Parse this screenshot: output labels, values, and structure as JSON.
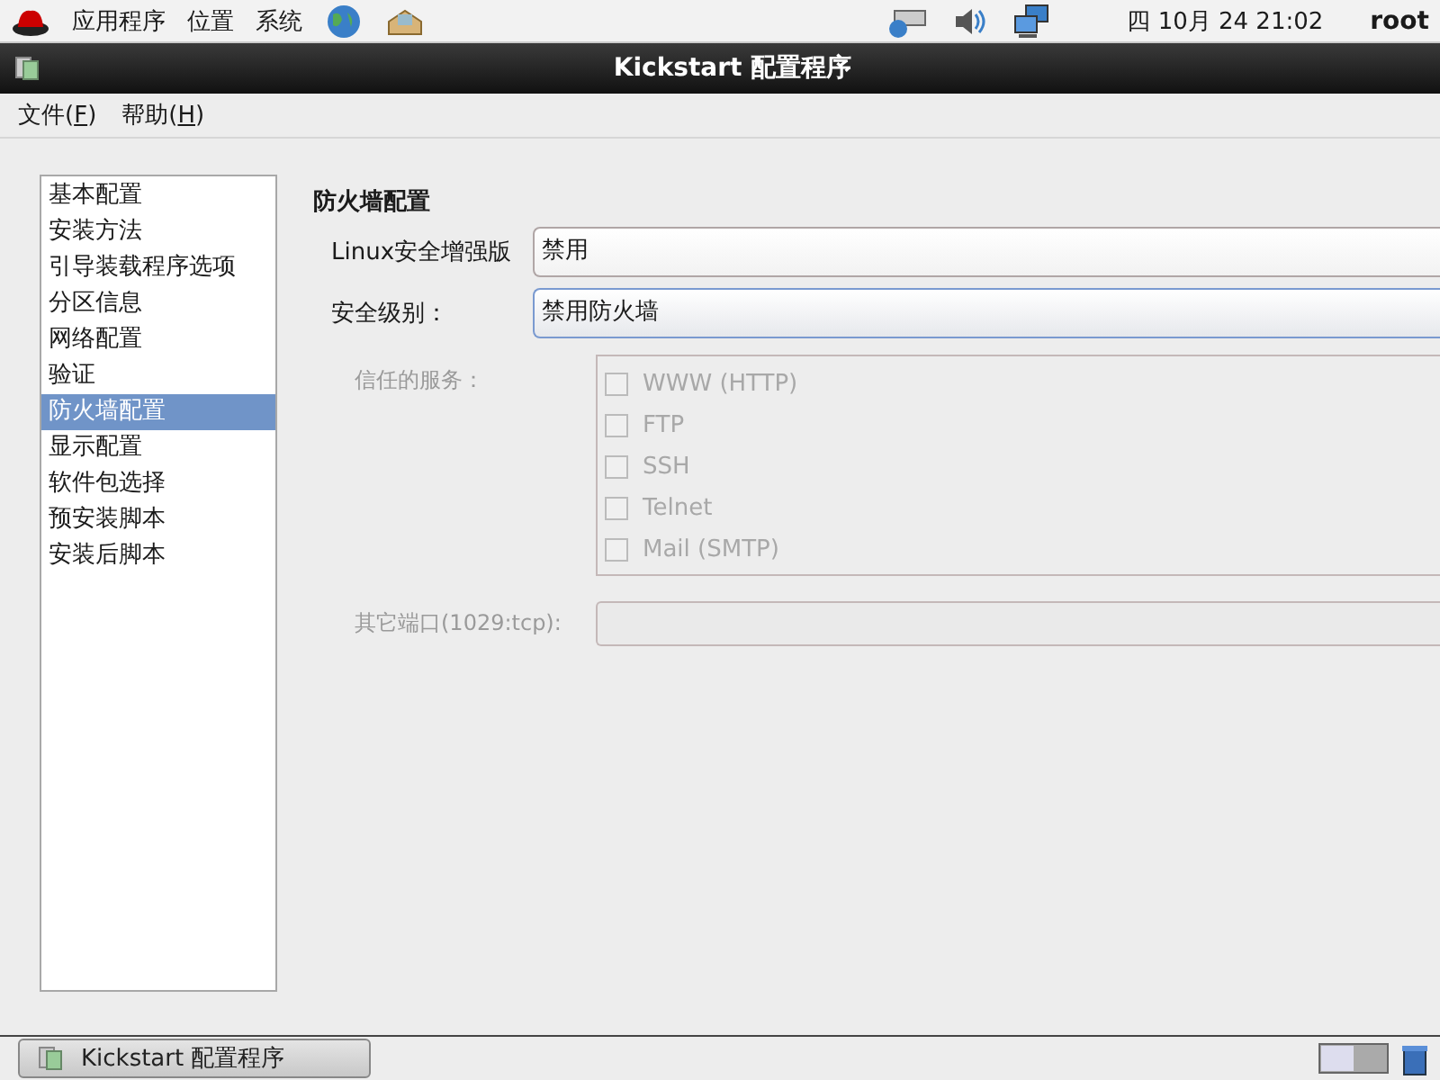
{
  "top_panel": {
    "menus": [
      "应用程序",
      "位置",
      "系统"
    ],
    "clock": "四 10月 24 21:02",
    "user": "root"
  },
  "window": {
    "title": "Kickstart 配置程序"
  },
  "menubar": [
    "文件(F)",
    "帮助(H)"
  ],
  "sidebar": {
    "items": [
      {
        "label": "基本配置",
        "selected": false
      },
      {
        "label": "安装方法",
        "selected": false
      },
      {
        "label": "引导装载程序选项",
        "selected": false
      },
      {
        "label": "分区信息",
        "selected": false
      },
      {
        "label": "网络配置",
        "selected": false
      },
      {
        "label": "验证",
        "selected": false
      },
      {
        "label": "防火墙配置",
        "selected": true
      },
      {
        "label": "显示配置",
        "selected": false
      },
      {
        "label": "软件包选择",
        "selected": false
      },
      {
        "label": "预安装脚本",
        "selected": false
      },
      {
        "label": "安装后脚本",
        "selected": false
      }
    ]
  },
  "section": {
    "title": "防火墙配置",
    "combos": [
      {
        "label": "Linux安全增强版",
        "value": "禁用",
        "focused": false
      },
      {
        "label": "安全级别：",
        "value": "禁用防火墙",
        "focused": true
      }
    ],
    "trusted_services": {
      "label": "信任的服务：",
      "disabled": true,
      "items": [
        {
          "label": "WWW (HTTP)",
          "checked": false
        },
        {
          "label": "FTP",
          "checked": false
        },
        {
          "label": "SSH",
          "checked": false
        },
        {
          "label": "Telnet",
          "checked": false
        },
        {
          "label": "Mail (SMTP)",
          "checked": false
        }
      ]
    },
    "other_ports": {
      "label": "其它端口(1029:tcp):",
      "disabled": true
    }
  },
  "taskbar": {
    "items": [
      {
        "label": "Kickstart 配置程序",
        "selected": false
      }
    ]
  }
}
